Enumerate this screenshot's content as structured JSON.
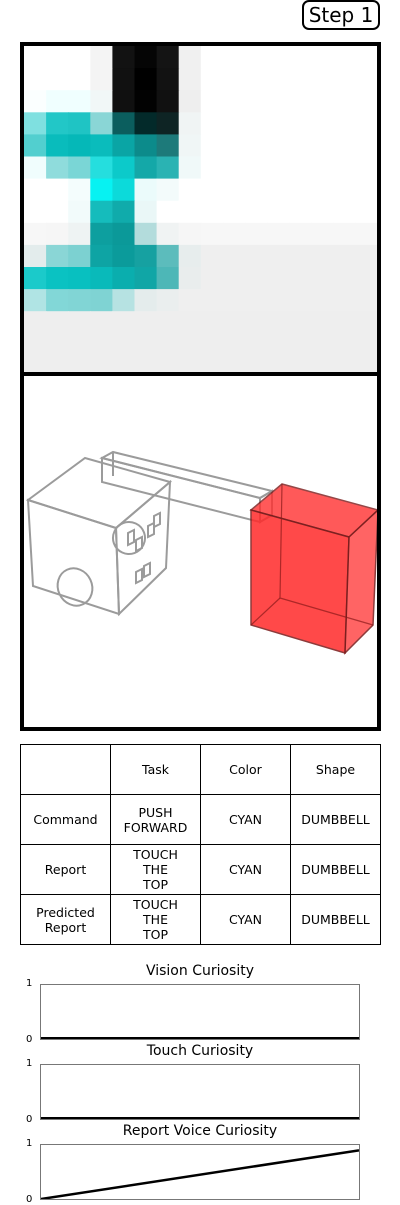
{
  "step_label": "Step 1",
  "vision_grid": {
    "rows": [
      [
        "#ffffff",
        "#ffffff",
        "#ffffff",
        "#f4f4f4",
        "#121212",
        "#050505",
        "#141414",
        "#f0f0f0",
        "#ffffff",
        "#ffffff",
        "#ffffff",
        "#ffffff",
        "#ffffff",
        "#ffffff",
        "#ffffff",
        "#ffffff"
      ],
      [
        "#ffffff",
        "#ffffff",
        "#ffffff",
        "#f4f4f4",
        "#111111",
        "#000000",
        "#121212",
        "#f0f0f0",
        "#ffffff",
        "#ffffff",
        "#ffffff",
        "#ffffff",
        "#ffffff",
        "#ffffff",
        "#ffffff",
        "#ffffff"
      ],
      [
        "#fbffff",
        "#f0ffff",
        "#f0ffff",
        "#f1f7f7",
        "#101010",
        "#020202",
        "#111111",
        "#eeeeee",
        "#ffffff",
        "#ffffff",
        "#ffffff",
        "#ffffff",
        "#ffffff",
        "#ffffff",
        "#ffffff",
        "#ffffff"
      ],
      [
        "#7fe0e0",
        "#22c7c7",
        "#1fc4c4",
        "#8ad6d6",
        "#0b5e5e",
        "#032a2a",
        "#0e2424",
        "#f0f4f4",
        "#ffffff",
        "#ffffff",
        "#ffffff",
        "#ffffff",
        "#ffffff",
        "#ffffff",
        "#ffffff",
        "#ffffff"
      ],
      [
        "#52cfcf",
        "#09bcbc",
        "#05b8b8",
        "#0abcbc",
        "#0aa5a5",
        "#0c8b8b",
        "#1d7a7a",
        "#f0f6f6",
        "#ffffff",
        "#ffffff",
        "#ffffff",
        "#ffffff",
        "#ffffff",
        "#ffffff",
        "#ffffff",
        "#ffffff"
      ],
      [
        "#f0fdfd",
        "#8fdcdc",
        "#7ad6d6",
        "#25dede",
        "#0ccaca",
        "#14a8a8",
        "#2ab3b3",
        "#f0f9f9",
        "#ffffff",
        "#ffffff",
        "#ffffff",
        "#ffffff",
        "#ffffff",
        "#ffffff",
        "#ffffff",
        "#ffffff"
      ],
      [
        "#ffffff",
        "#ffffff",
        "#f4fdfd",
        "#07f2f2",
        "#0cdada",
        "#ebfbfb",
        "#f3fbfb",
        "#ffffff",
        "#ffffff",
        "#ffffff",
        "#ffffff",
        "#ffffff",
        "#ffffff",
        "#ffffff",
        "#ffffff",
        "#ffffff"
      ],
      [
        "#ffffff",
        "#ffffff",
        "#f2fbfb",
        "#15bcbc",
        "#10abab",
        "#eaf7f7",
        "#ffffff",
        "#ffffff",
        "#ffffff",
        "#ffffff",
        "#ffffff",
        "#ffffff",
        "#ffffff",
        "#ffffff",
        "#ffffff",
        "#ffffff"
      ],
      [
        "#f7f7f7",
        "#f6f6f6",
        "#eef3f3",
        "#0d9f9f",
        "#0b9999",
        "#b3dcdc",
        "#f0f3f3",
        "#f6f6f6",
        "#f7f7f7",
        "#f7f7f7",
        "#f7f7f7",
        "#f7f7f7",
        "#f7f7f7",
        "#f7f7f7",
        "#f7f7f7",
        "#f7f7f7"
      ],
      [
        "#e3ecec",
        "#8ad6d6",
        "#7cd1d1",
        "#0ea4a4",
        "#0b9b9b",
        "#16a1a1",
        "#5cbcbc",
        "#e7eded",
        "#efefef",
        "#efefef",
        "#efefef",
        "#efefef",
        "#efefef",
        "#efefef",
        "#efefef",
        "#efefef"
      ],
      [
        "#1bcaca",
        "#0ac2c2",
        "#08c0c0",
        "#09baba",
        "#0aaeae",
        "#10a6a6",
        "#4db7b7",
        "#e9eded",
        "#efefef",
        "#efefef",
        "#efefef",
        "#efefef",
        "#efefef",
        "#efefef",
        "#efefef",
        "#efefef"
      ],
      [
        "#b0e4e4",
        "#82d7d7",
        "#81d5d5",
        "#7fd3d3",
        "#b6e2e2",
        "#e4ecec",
        "#eaeeee",
        "#efefef",
        "#efefef",
        "#efefef",
        "#efefef",
        "#efefef",
        "#efefef",
        "#efefef",
        "#efefef",
        "#efefef"
      ],
      [
        "#eeeeee",
        "#eeeeee",
        "#eeeeee",
        "#eeeeee",
        "#eeeeee",
        "#eeeeee",
        "#eeeeee",
        "#eeeeee",
        "#eeeeee",
        "#eeeeee",
        "#eeeeee",
        "#eeeeee",
        "#eeeeee",
        "#eeeeee",
        "#eeeeee",
        "#eeeeee"
      ],
      [
        "#eeeeee",
        "#eeeeee",
        "#eeeeee",
        "#eeeeee",
        "#eeeeee",
        "#eeeeee",
        "#eeeeee",
        "#eeeeee",
        "#eeeeee",
        "#eeeeee",
        "#eeeeee",
        "#eeeeee",
        "#eeeeee",
        "#eeeeee",
        "#eeeeee",
        "#eeeeee"
      ],
      [
        "#eeeeee",
        "#eeeeee",
        "#eeeeee",
        "#eeeeee",
        "#eeeeee",
        "#eeeeee",
        "#eeeeee",
        "#eeeeee",
        "#eeeeee",
        "#eeeeee",
        "#eeeeee",
        "#eeeeee",
        "#eeeeee",
        "#eeeeee",
        "#eeeeee",
        "#eeeeee"
      ]
    ]
  },
  "scene": {
    "target_color": "#ff3030",
    "wire_color": "#8a8a8a"
  },
  "table": {
    "headers": [
      "",
      "Task",
      "Color",
      "Shape"
    ],
    "rows": [
      {
        "label": "Command",
        "task": "PUSH\nFORWARD",
        "color": "CYAN",
        "shape": "DUMBBELL"
      },
      {
        "label": "Report",
        "task": "TOUCH\nTHE\nTOP",
        "color": "CYAN",
        "shape": "DUMBBELL"
      },
      {
        "label": "Predicted\nReport",
        "task": "TOUCH\nTHE\nTOP",
        "color": "CYAN",
        "shape": "DUMBBELL"
      }
    ]
  },
  "curiosity": {
    "vision": {
      "title": "Vision Curiosity",
      "ymax": "1",
      "ymin": "0",
      "values": []
    },
    "touch": {
      "title": "Touch Curiosity",
      "ymax": "1",
      "ymin": "0",
      "values": []
    },
    "voice": {
      "title": "Report Voice Curiosity",
      "ymax": "1",
      "ymin": "0",
      "values": [
        0,
        0.9
      ]
    }
  }
}
